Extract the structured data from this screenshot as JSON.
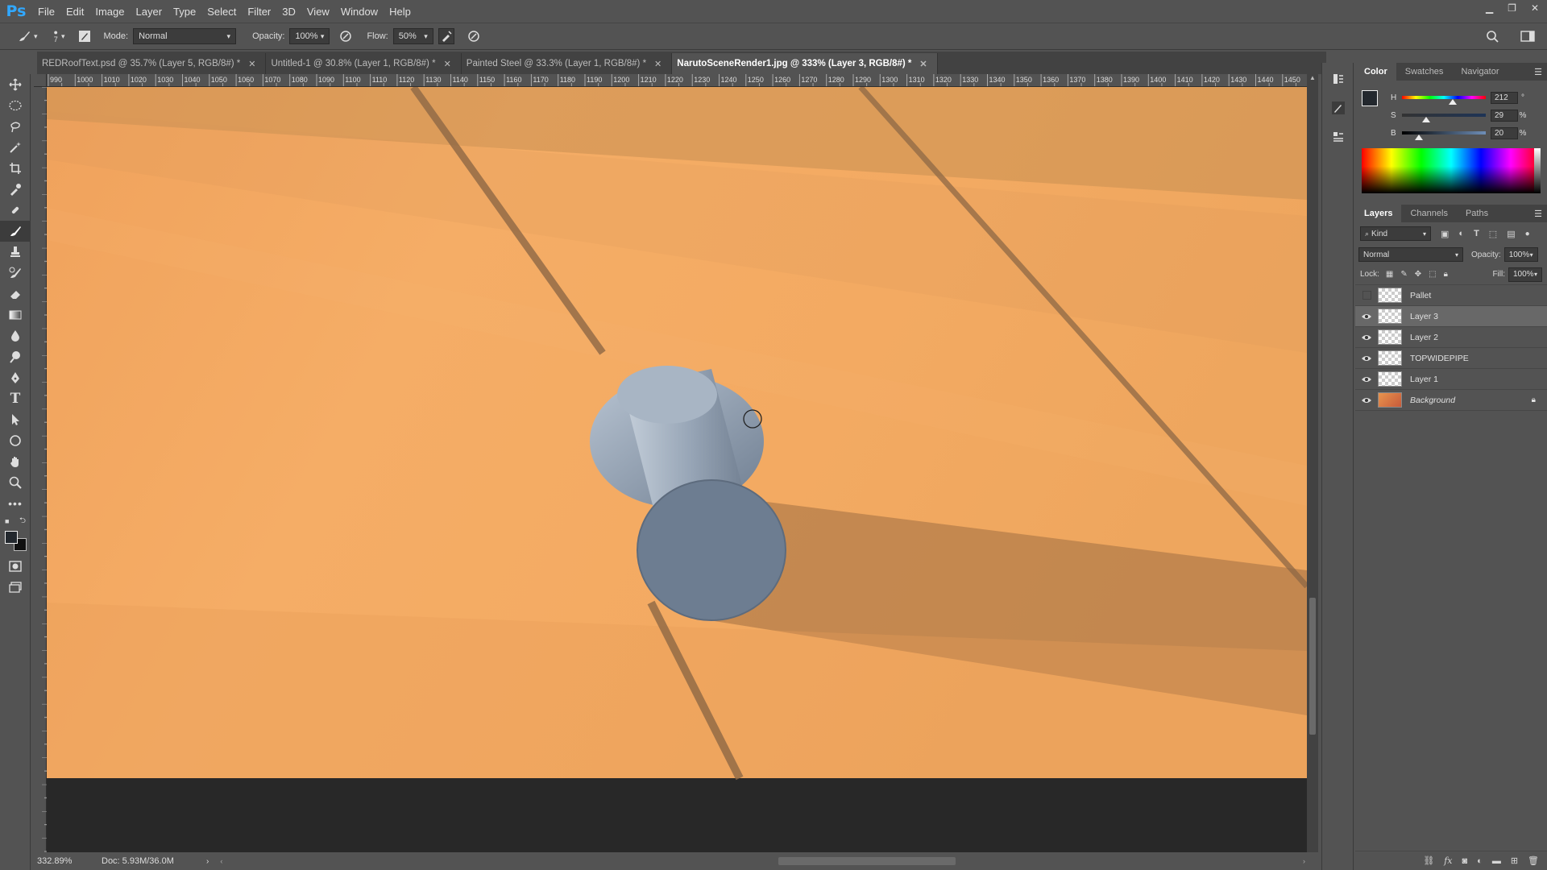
{
  "app": {
    "logo": "Ps"
  },
  "menu": [
    "File",
    "Edit",
    "Image",
    "Layer",
    "Type",
    "Select",
    "Filter",
    "3D",
    "View",
    "Window",
    "Help"
  ],
  "options": {
    "brush_size": "7",
    "mode_label": "Mode:",
    "mode_value": "Normal",
    "opacity_label": "Opacity:",
    "opacity_value": "100%",
    "flow_label": "Flow:",
    "flow_value": "50%"
  },
  "tabs": [
    {
      "label": "REDRoofText.psd @ 35.7% (Layer 5, RGB/8#) *"
    },
    {
      "label": "Untitled-1 @ 30.8% (Layer 1, RGB/8#) *"
    },
    {
      "label": "Painted Steel @ 33.3% (Layer 1, RGB/8#) *"
    },
    {
      "label": "NarutoSceneRender1.jpg @ 333% (Layer 3, RGB/8#) *"
    }
  ],
  "ruler_ticks": [
    "990",
    "1000",
    "1010",
    "1020",
    "1030",
    "1040",
    "1050",
    "1060",
    "1070",
    "1080",
    "1090",
    "1100",
    "1110",
    "1120",
    "1130",
    "1140",
    "1150",
    "1160",
    "1170",
    "1180",
    "1190",
    "1200",
    "1210",
    "1220",
    "1230",
    "1240",
    "1250",
    "1260",
    "1270",
    "1280",
    "1290",
    "1300",
    "1310",
    "1320",
    "1330",
    "1340",
    "1350",
    "1360",
    "1370",
    "1380",
    "1390",
    "1400",
    "1410",
    "1420",
    "1430",
    "1440",
    "1450"
  ],
  "status": {
    "zoom": "332.89%",
    "doc": "Doc: 5.93M/36.0M"
  },
  "color_panel": {
    "tabs": [
      "Color",
      "Swatches",
      "Navigator"
    ],
    "h": {
      "label": "H",
      "value": "212",
      "unit": "°"
    },
    "s": {
      "label": "S",
      "value": "29",
      "unit": "%"
    },
    "b": {
      "label": "B",
      "value": "20",
      "unit": "%"
    }
  },
  "layers_panel": {
    "tabs": [
      "Layers",
      "Channels",
      "Paths"
    ],
    "filter_kind": "Kind",
    "blend_mode": "Normal",
    "opacity_label": "Opacity:",
    "opacity_value": "100%",
    "lock_label": "Lock:",
    "fill_label": "Fill:",
    "fill_value": "100%",
    "layers": [
      {
        "name": "Pallet",
        "visible": false,
        "selected": false
      },
      {
        "name": "Layer 3",
        "visible": true,
        "selected": true
      },
      {
        "name": "Layer 2",
        "visible": true,
        "selected": false
      },
      {
        "name": "TOPWIDEPIPE",
        "visible": true,
        "selected": false
      },
      {
        "name": "Layer 1",
        "visible": true,
        "selected": false
      },
      {
        "name": "Background",
        "visible": true,
        "selected": false,
        "locked": true
      }
    ]
  }
}
